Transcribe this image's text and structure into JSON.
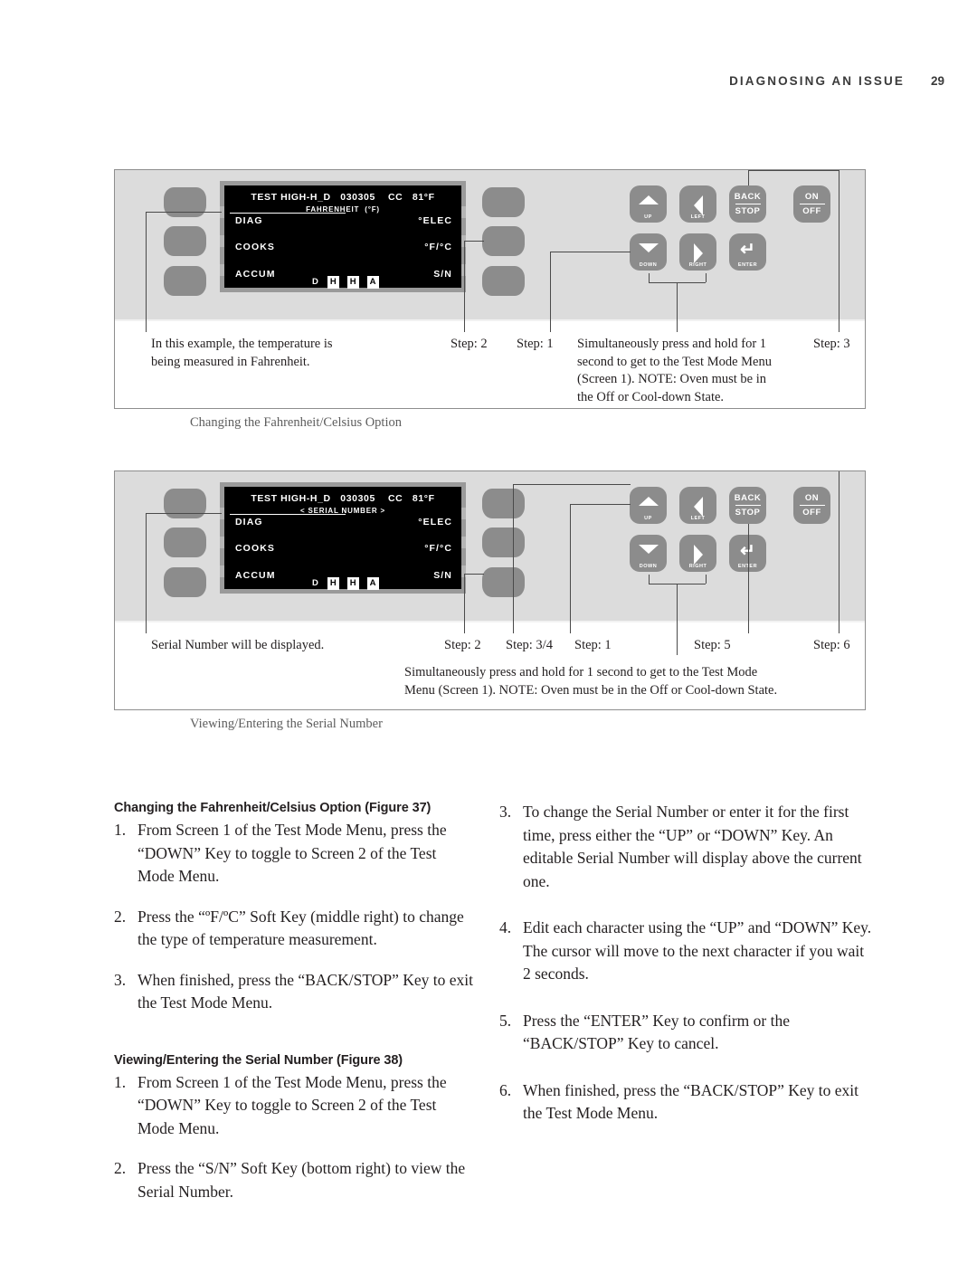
{
  "header": {
    "title": "DIAGNOSING AN ISSUE",
    "page_number": "29"
  },
  "lcd_common": {
    "topline": "TEST HIGH-H_D   030305    CC   81°F",
    "softkeys_left": [
      "DIAG",
      "COOKS",
      "ACCUM"
    ],
    "softkeys_right": [
      "°ELEC",
      "°F/°C",
      "S/N"
    ],
    "char_row": [
      {
        "text": "D",
        "boxed": false
      },
      {
        "text": "H",
        "boxed": true
      },
      {
        "text": "H",
        "boxed": true
      },
      {
        "text": "A",
        "boxed": true
      }
    ]
  },
  "keypad": {
    "up": {
      "label": "UP",
      "icon": "triangle-up-icon"
    },
    "left": {
      "label": "LEFT",
      "icon": "triangle-left-icon"
    },
    "down": {
      "label": "DOWN",
      "icon": "triangle-down-icon"
    },
    "right": {
      "label": "RIGHT",
      "icon": "triangle-right-icon"
    },
    "enter": {
      "label": "ENTER",
      "icon": "enter-arrow-icon"
    },
    "back_stop": {
      "top": "BACK",
      "bottom": "STOP"
    },
    "on_off": {
      "top": "ON",
      "bottom": "OFF"
    }
  },
  "figure37": {
    "lcd_subline": "FAHRENHEIT  (°F)",
    "caption_left": [
      "In this example, the temperature is",
      "being measured in Fahrenheit."
    ],
    "step_a": "Step: 2",
    "step_b": "Step: 1",
    "note": [
      "Simultaneously press and hold for 1",
      "second to get to the Test Mode Menu",
      "(Screen 1). NOTE: Oven must be in",
      "the Off or Cool-down State."
    ],
    "step_c": "Step: 3",
    "title": "Changing the Fahrenheit/Celsius Option"
  },
  "figure38": {
    "lcd_subline": "< SERIAL NUMBER >",
    "caption_left": "Serial Number will be displayed.",
    "step_a": "Step: 2",
    "step_b": "Step: 3/4",
    "step_c": "Step: 1",
    "step_d": "Step: 5",
    "step_e": "Step: 6",
    "note": [
      "Simultaneously press and hold for 1 second to get to the Test Mode",
      "Menu (Screen 1). NOTE: Oven must be in the Off or Cool-down State."
    ],
    "title": "Viewing/Entering the Serial Number"
  },
  "body": {
    "section1": {
      "heading": "Changing the Fahrenheit/Celsius Option (Figure 37)",
      "steps": [
        {
          "num": "1.",
          "text": "From Screen 1 of the Test Mode Menu, press the “DOWN” Key to toggle to Screen 2 of the Test Mode Menu."
        },
        {
          "num": "2.",
          "text": "Press the “ºF/ºC” Soft Key (middle right) to change the type of temperature measurement."
        },
        {
          "num": "3.",
          "text": "When finished, press the “BACK/STOP” Key to exit the Test Mode Menu."
        }
      ]
    },
    "section2": {
      "heading": "Viewing/Entering the Serial Number (Figure 38)",
      "steps": [
        {
          "num": "1.",
          "text": "From Screen 1 of the Test Mode Menu, press the “DOWN” Key to toggle to Screen 2 of the Test Mode Menu."
        },
        {
          "num": "2.",
          "text": "Press the “S/N” Soft Key (bottom right) to view the Serial Number."
        }
      ]
    },
    "section3": {
      "steps": [
        {
          "num": "3.",
          "text": "To change the Serial Number or enter it for the first time, press either the “UP” or “DOWN” Key. An editable Serial Number will display above the current one."
        },
        {
          "num": "4.",
          "text": "Edit each character using the “UP” and “DOWN” Key. The cursor will move to the next character if you wait 2 seconds."
        },
        {
          "num": "5.",
          "text": "Press the “ENTER” Key to confirm or the “BACK/STOP” Key to cancel."
        },
        {
          "num": "6.",
          "text": "When finished, press the “BACK/STOP” Key to exit the Test Mode Menu."
        }
      ]
    }
  },
  "colors": {
    "panel_bg": "#dcdcdc",
    "key_grey": "#8c8c8c",
    "lcd_bg": "#000000",
    "text": "#231f20"
  }
}
